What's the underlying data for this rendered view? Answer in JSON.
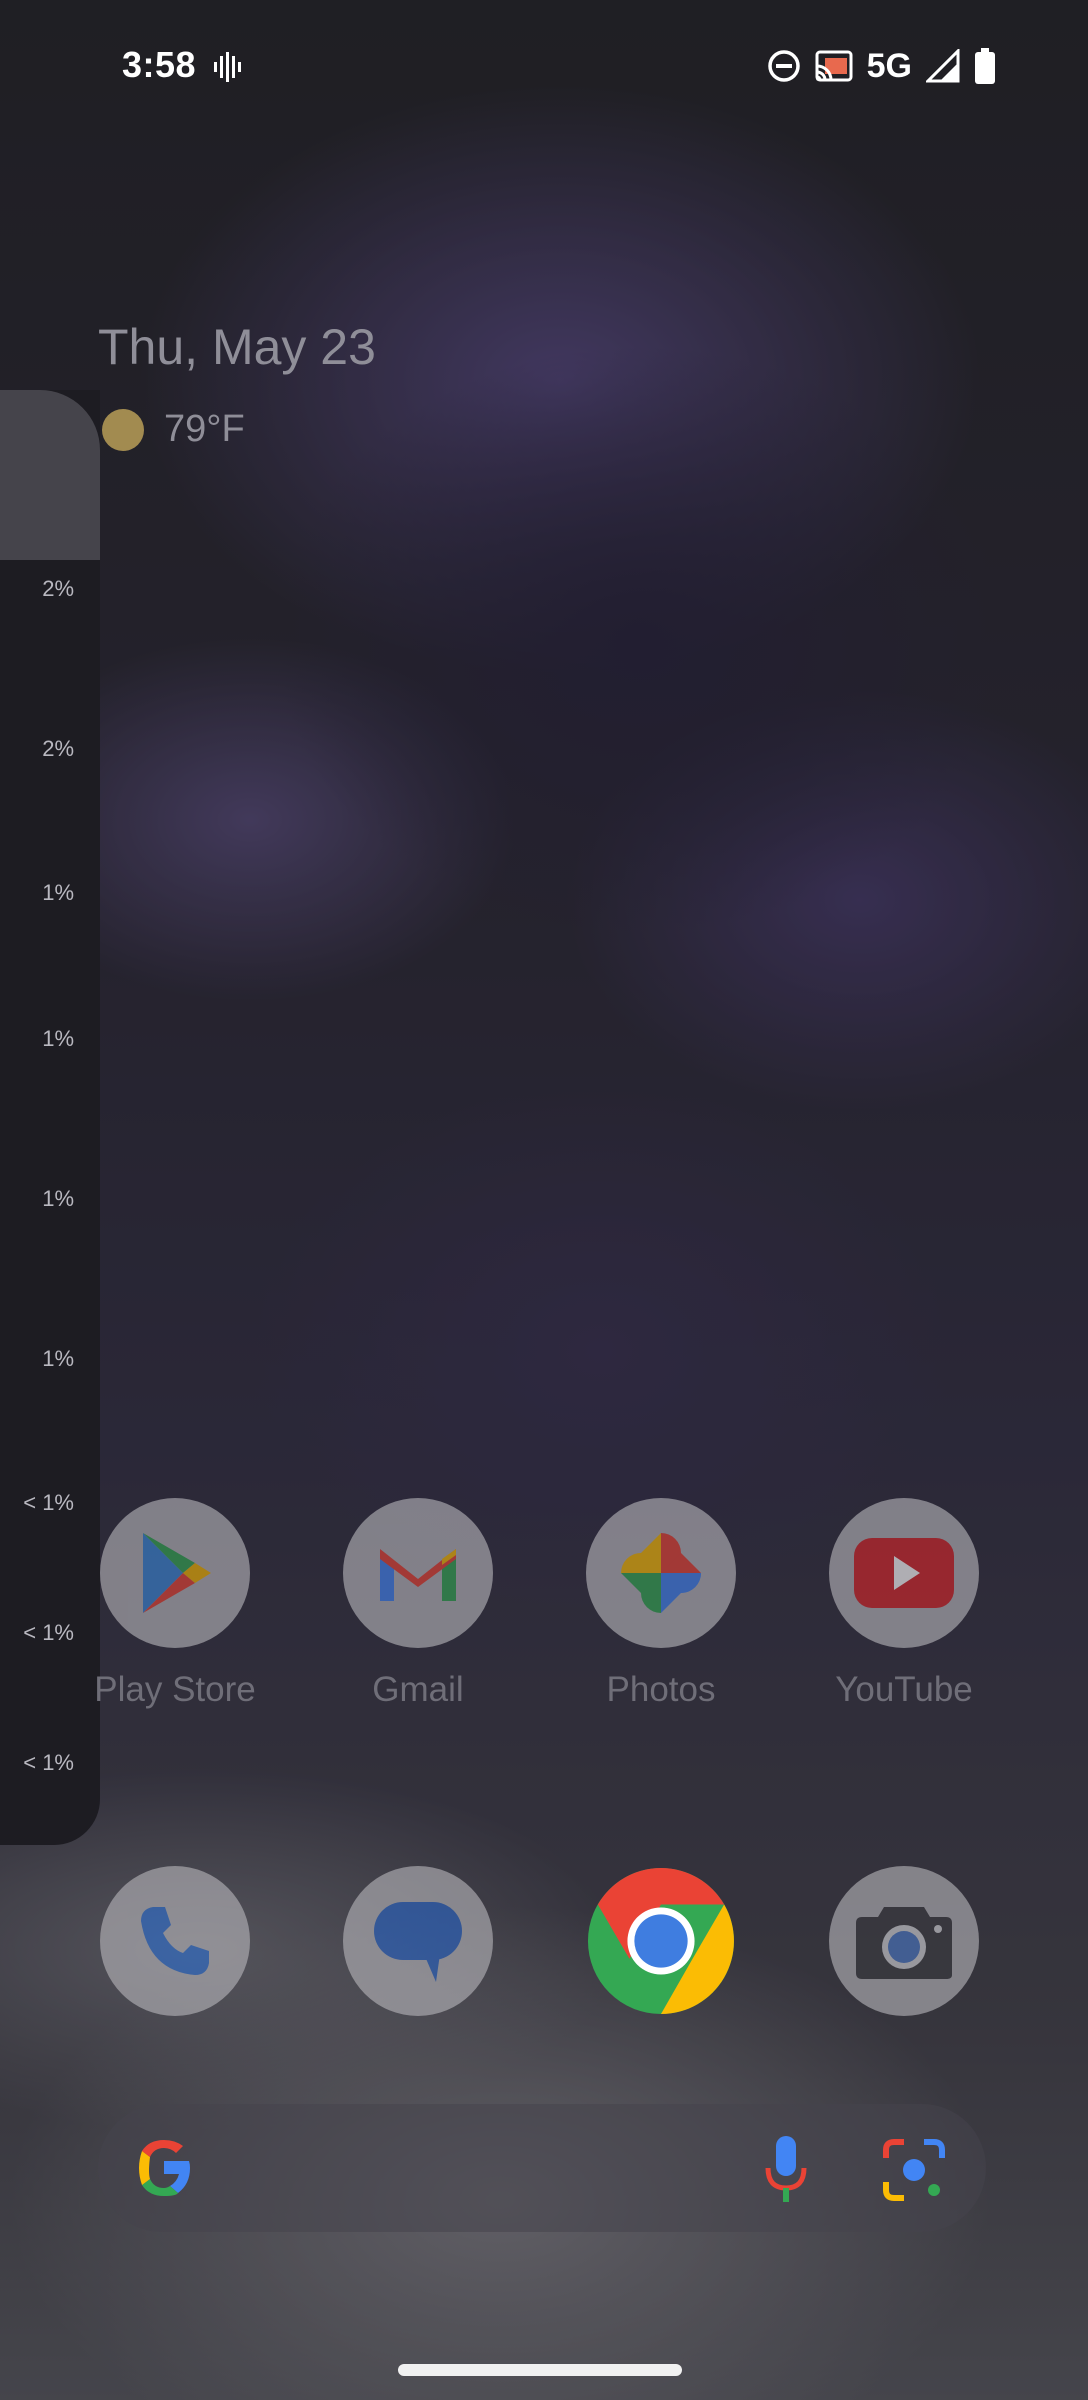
{
  "status_bar": {
    "time": "3:58",
    "network": "5G",
    "icons": [
      "vibration-icon",
      "do-not-disturb-icon",
      "cast-icon",
      "signal-icon",
      "battery-icon"
    ]
  },
  "widget": {
    "date": "Thu, May 23",
    "temperature": "79°F",
    "weather_icon": "sun-icon"
  },
  "side_panel": {
    "usage_values": [
      "2%",
      "2%",
      "1%",
      "1%",
      "1%",
      "1%",
      "< 1%",
      "< 1%",
      "< 1%"
    ]
  },
  "apps": {
    "row1": [
      {
        "label": "Play Store",
        "icon": "play-store-icon"
      },
      {
        "label": "Gmail",
        "icon": "gmail-icon"
      },
      {
        "label": "Photos",
        "icon": "photos-icon"
      },
      {
        "label": "YouTube",
        "icon": "youtube-icon"
      }
    ],
    "dock": [
      {
        "icon": "phone-icon"
      },
      {
        "icon": "messages-icon"
      },
      {
        "icon": "chrome-icon"
      },
      {
        "icon": "camera-icon"
      }
    ]
  },
  "search": {
    "icons": [
      "google-g-icon",
      "microphone-icon",
      "lens-icon"
    ]
  }
}
